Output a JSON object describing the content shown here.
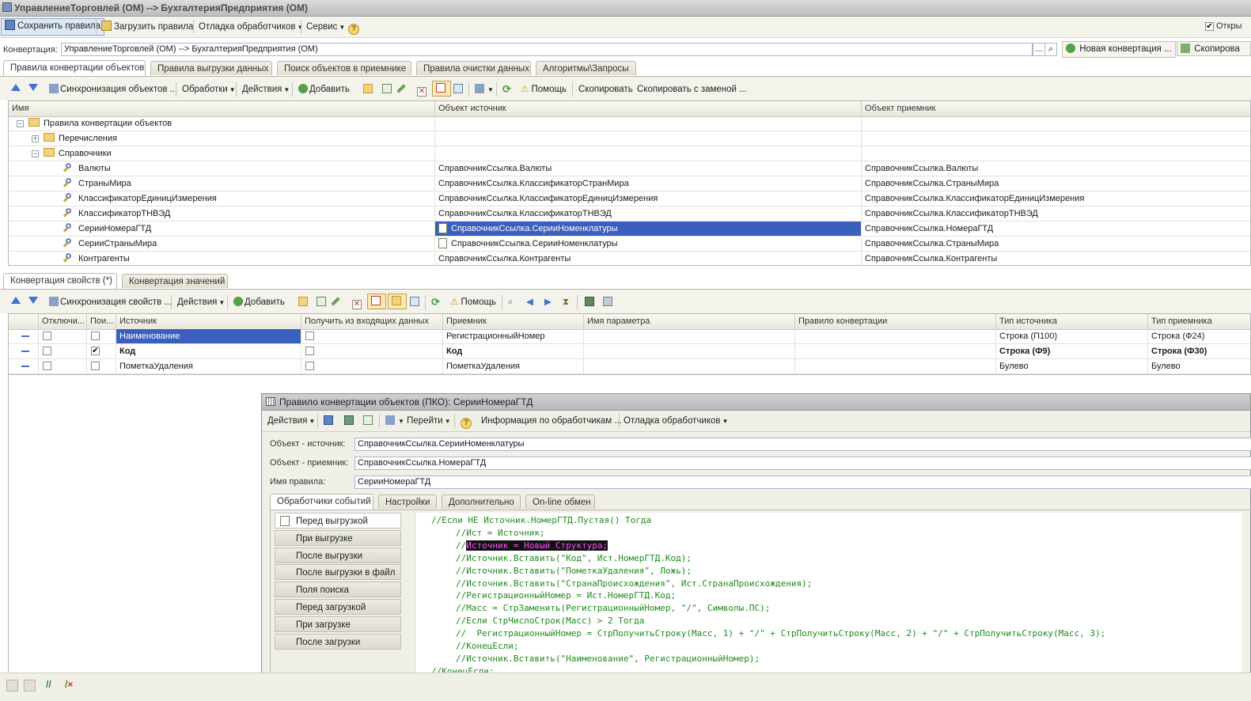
{
  "window": {
    "title": "УправлениеТорговлей (ОМ) --> БухгалтерияПредприятия (ОМ)"
  },
  "main_toolbar": {
    "save": "Сохранить правила",
    "load": "Загрузить правила",
    "debug": "Отладка обработчиков",
    "service": "Сервис",
    "help": "?",
    "right_checkbox": "Откры"
  },
  "conversion": {
    "label": "Конвертация:",
    "value": "УправлениеТорговлей (ОМ) --> БухгалтерияПредприятия (ОМ)",
    "browse": "...",
    "new_button": "Новая конвертация ...",
    "copy_button": "Скопирова"
  },
  "top_tabs": [
    "Правила конвертации объектов",
    "Правила выгрузки данных",
    "Поиск объектов в приемнике",
    "Правила очистки данных",
    "Алгоритмы\\Запросы"
  ],
  "rules_toolbar": {
    "sync": "Синхронизация объектов ...",
    "processing": "Обработки",
    "actions": "Действия",
    "add": "Добавить",
    "help": "Помощь",
    "copy": "Скопировать",
    "copy_replace": "Скопировать с заменой ..."
  },
  "rules_grid": {
    "columns": [
      "Имя",
      "Объект источник",
      "Объект приемник"
    ],
    "rows": [
      {
        "level": 0,
        "type": "folder",
        "expander": "⊖",
        "name": "Правила конвертации объектов",
        "source": "",
        "target": ""
      },
      {
        "level": 1,
        "type": "folder",
        "expander": "⊕",
        "name": "Перечисления",
        "source": "",
        "target": ""
      },
      {
        "level": 1,
        "type": "folder",
        "expander": "⊖",
        "name": "Справочники",
        "source": "",
        "target": ""
      },
      {
        "level": 2,
        "type": "rule",
        "name": "Валюты",
        "source": "СправочникСсылка.Валюты",
        "target": "СправочникСсылка.Валюты"
      },
      {
        "level": 2,
        "type": "rule",
        "name": "СтраныМира",
        "source": "СправочникСсылка.КлассификаторСтранМира",
        "target": "СправочникСсылка.СтраныМира"
      },
      {
        "level": 2,
        "type": "rule",
        "name": "КлассификаторЕдиницИзмерения",
        "source": "СправочникСсылка.КлассификаторЕдиницИзмерения",
        "target": "СправочникСсылка.КлассификаторЕдиницИзмерения"
      },
      {
        "level": 2,
        "type": "rule",
        "name": "КлассификаторТНВЭД",
        "source": "СправочникСсылка.КлассификаторТНВЭД",
        "target": "СправочникСсылка.КлассификаторТНВЭД"
      },
      {
        "level": 2,
        "type": "rule",
        "name": "СерииНомераГТД",
        "source": "СправочникСсылка.СерииНоменклатуры",
        "target": "СправочникСсылка.НомераГТД",
        "selected": true
      },
      {
        "level": 2,
        "type": "rule",
        "name": "СерииСтраныМира",
        "source": "СправочникСсылка.СерииНоменклатуры",
        "target": "СправочникСсылка.СтраныМира"
      },
      {
        "level": 2,
        "type": "rule",
        "name": "Контрагенты",
        "source": "СправочникСсылка.Контрагенты",
        "target": "СправочникСсылка.Контрагенты"
      }
    ]
  },
  "bottom_tabs": [
    "Конвертация свойств (*)",
    "Конвертация значений"
  ],
  "props_toolbar": {
    "sync": "Синхронизация свойств ...",
    "actions": "Действия",
    "add": "Добавить",
    "help": "Помощь"
  },
  "props_grid": {
    "columns": [
      "Отключи...",
      "Пои...",
      "Источник",
      "Получить из входящих данных",
      "Приемник",
      "Имя параметра",
      "Правило конвертации",
      "Тип источника",
      "Тип приемника"
    ],
    "rows": [
      {
        "disabled": false,
        "search": false,
        "source": "Наименование",
        "incoming": false,
        "target": "РегистрационныйНомер",
        "param": "",
        "rule": "",
        "src_type": "Строка (П100)",
        "dst_type": "Строка (Ф24)",
        "bold": false,
        "selected": true
      },
      {
        "disabled": false,
        "search": true,
        "source": "Код",
        "incoming": false,
        "target": "Код",
        "param": "",
        "rule": "",
        "src_type": "Строка (Ф9)",
        "dst_type": "Строка (Ф30)",
        "bold": true,
        "selected": false
      },
      {
        "disabled": false,
        "search": false,
        "source": "ПометкаУдаления",
        "incoming": false,
        "target": "ПометкаУдаления",
        "param": "",
        "rule": "",
        "src_type": "Булево",
        "dst_type": "Булево",
        "bold": false,
        "selected": false
      }
    ]
  },
  "modal": {
    "title": "Правило конвертации объектов (ПКО): СерииНомераГТД",
    "toolbar": {
      "actions": "Действия",
      "goto": "Перейти",
      "info": "Информация по обработчикам ...",
      "debug": "Отладка обработчиков"
    },
    "fields": {
      "source_label": "Объект - источник:",
      "source_value": "СправочникСсылка.СерииНоменклатуры",
      "target_label": "Объект - приемник:",
      "target_value": "СправочникСсылка.НомераГТД",
      "name_label": "Имя правила:",
      "name_value": "СерииНомераГТД"
    },
    "tabs": [
      "Обработчики событий",
      "Настройки",
      "Дополнительно",
      "On-line обмен"
    ],
    "events": [
      "Перед выгрузкой",
      "При выгрузке",
      "После выгрузки",
      "После выгрузки в файл",
      "Поля поиска",
      "Перед загрузкой",
      "При загрузке",
      "После загрузки"
    ],
    "code": [
      {
        "indent": 0,
        "text": "//Если НЕ Источник.НомерГТД.Пустая() Тогда"
      },
      {
        "indent": 1,
        "text": "//Ист = Источник;"
      },
      {
        "indent": 1,
        "prefix": "//",
        "highlight": "Источник = Новый Структура;"
      },
      {
        "indent": 1,
        "text": "//Источник.Вставить(\"Код\", Ист.НомерГТД.Код);"
      },
      {
        "indent": 1,
        "text": "//Источник.Вставить(\"ПометкаУдаления\", Ложь);"
      },
      {
        "indent": 1,
        "text": "//Источник.Вставить(\"СтранаПроисхождения\", Ист.СтранаПроисхождения);"
      },
      {
        "indent": 1,
        "text": "//РегистрационныйНомер = Ист.НомерГТД.Код;"
      },
      {
        "indent": 1,
        "text": "//Масс = СтрЗаменить(РегистрационныйНомер, \"/\", Символы.ПС);"
      },
      {
        "indent": 1,
        "text": "//Если СтрЧислоСтрок(Масс) > 2 Тогда"
      },
      {
        "indent": 1,
        "text": "//  РегистрационныйНомер = СтрПолучитьСтроку(Масс, 1) + \"/\" + СтрПолучитьСтроку(Масс, 2) + \"/\" + СтрПолучитьСтроку(Масс, 3);"
      },
      {
        "indent": 1,
        "text": "//КонецЕсли;"
      },
      {
        "indent": 1,
        "text": "//Источник.Вставить(\"Наименование\", РегистрационныйНомер);"
      },
      {
        "indent": 0,
        "text": "//КонецЕсли;"
      }
    ]
  },
  "colors": {
    "selection": "#3b5fbf",
    "code_comment": "#1f8a1f",
    "code_highlight_fg": "#ff4dff"
  }
}
